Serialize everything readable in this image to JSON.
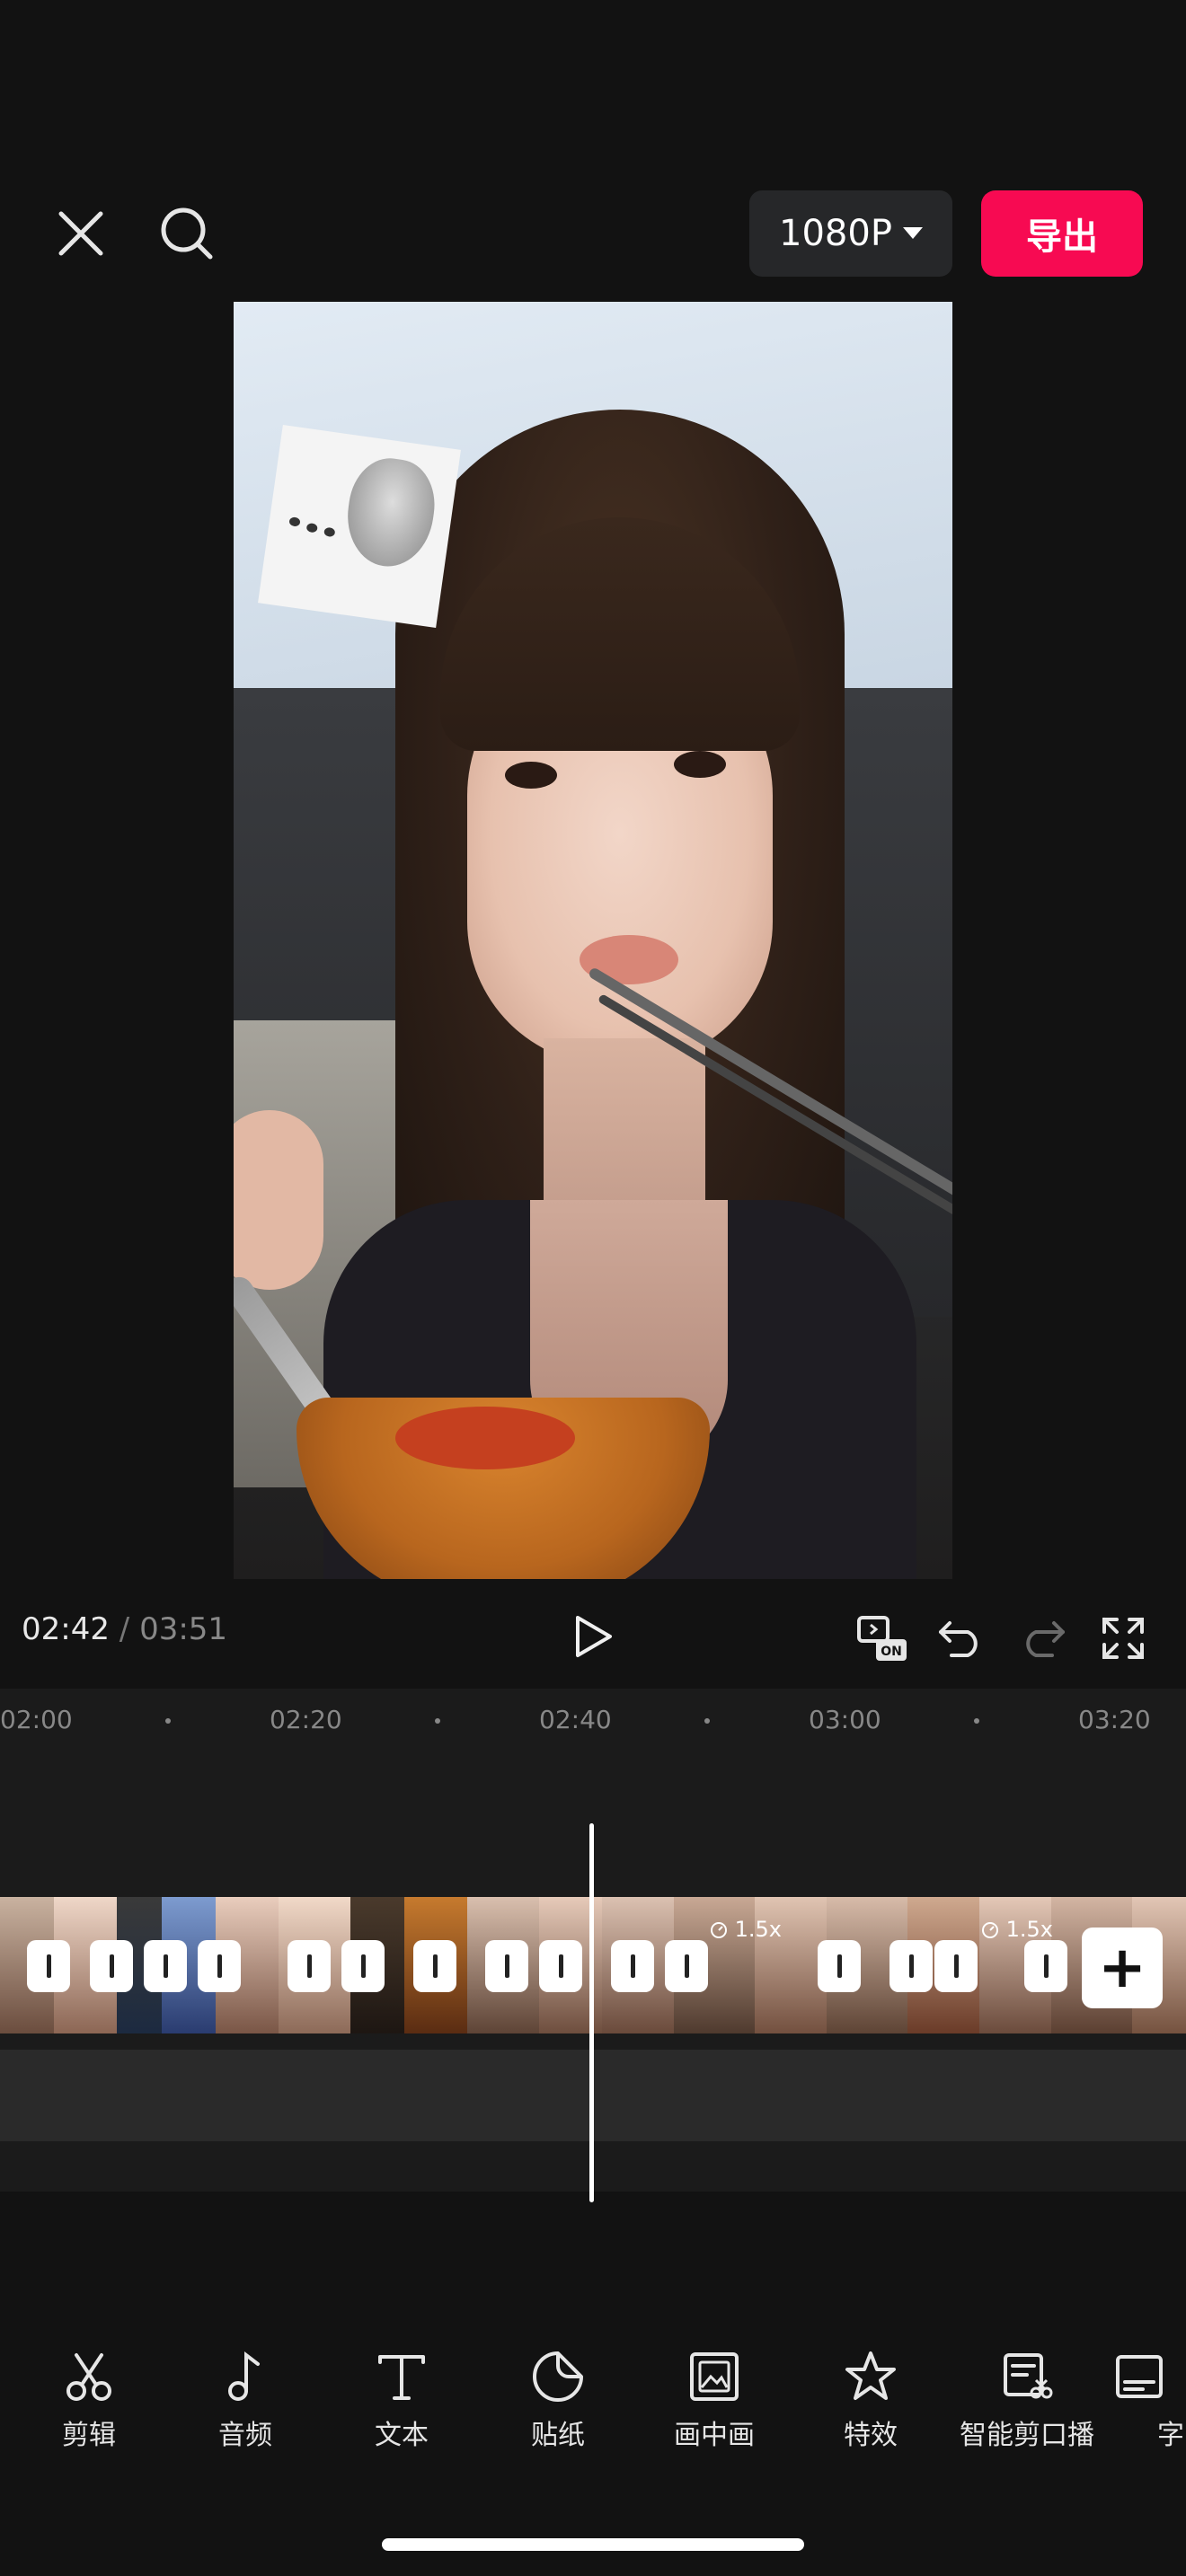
{
  "header": {
    "resolution": "1080P",
    "export_label": "导出"
  },
  "player": {
    "current_time": "02:42",
    "separator": "/",
    "total_time": "03:51"
  },
  "ruler": {
    "ticks": [
      "02:00",
      "02:20",
      "02:40",
      "03:00",
      "03:20"
    ]
  },
  "timeline": {
    "speed_labels": [
      "1.5x",
      "1.5x"
    ]
  },
  "toolbar": {
    "items": [
      {
        "label": "剪辑",
        "icon": "scissors-icon"
      },
      {
        "label": "音频",
        "icon": "music-note-icon"
      },
      {
        "label": "文本",
        "icon": "text-icon"
      },
      {
        "label": "贴纸",
        "icon": "sticker-icon"
      },
      {
        "label": "画中画",
        "icon": "picture-in-picture-icon"
      },
      {
        "label": "特效",
        "icon": "effects-star-icon"
      },
      {
        "label": "智能剪口播",
        "icon": "smart-cut-icon"
      },
      {
        "label": "字",
        "icon": "subtitle-icon"
      }
    ]
  }
}
